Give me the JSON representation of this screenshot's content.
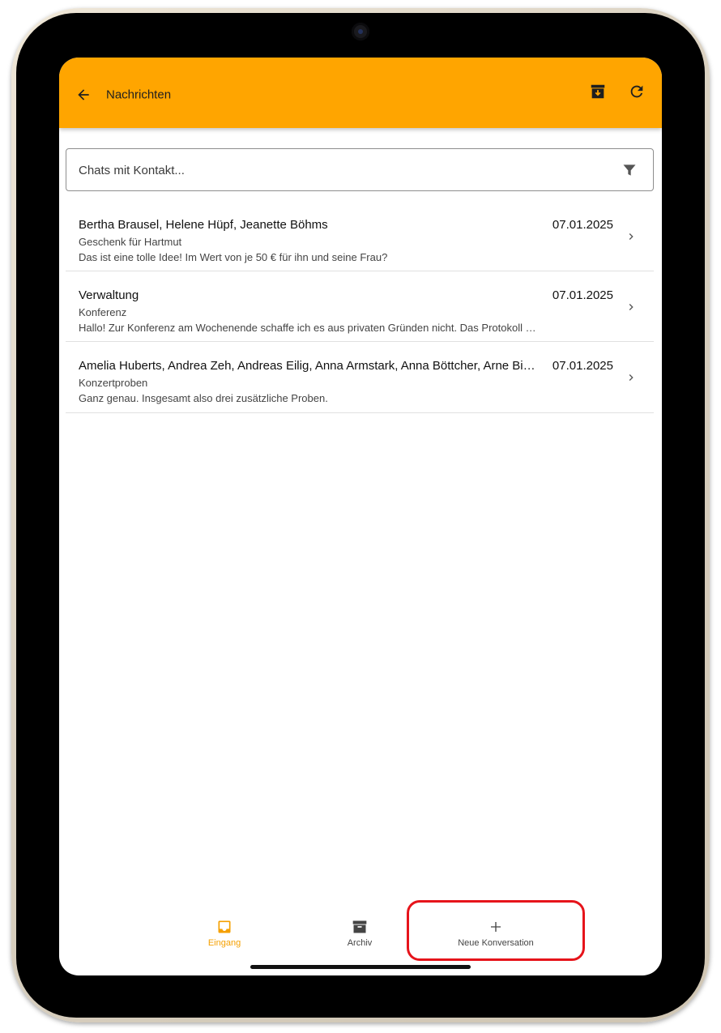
{
  "colors": {
    "accent": "#FFA500",
    "nav_active": "#F5A000",
    "nav_inactive": "#444444",
    "highlight": "#E6141B"
  },
  "header": {
    "title": "Nachrichten",
    "back_icon": "arrow-left-icon",
    "archive_icon": "archive-download-icon",
    "refresh_icon": "refresh-icon"
  },
  "search": {
    "placeholder": "Chats mit Kontakt...",
    "value": "",
    "filter_icon": "filter-icon"
  },
  "chats": [
    {
      "names": "Bertha Brausel, Helene Hüpf, Jeanette Böhms",
      "date": "07.01.2025",
      "subject": "Geschenk für Hartmut",
      "preview": "Das ist eine tolle Idee! Im Wert von je 50 € für ihn und seine Frau?"
    },
    {
      "names": "Verwaltung",
      "date": "07.01.2025",
      "subject": "Konferenz",
      "preview": "Hallo! Zur Konferenz am Wochenende schaffe ich es aus privaten Gründen nicht. Das Protokoll müsste also jemand anderes übernehmen."
    },
    {
      "names": "Amelia Huberts, Andrea Zeh, Andreas Eilig, Anna Armstark, Anna Böttcher, Arne Bis...",
      "date": "07.01.2025",
      "subject": "Konzertproben",
      "preview": "Ganz genau. Insgesamt also drei zusätzliche Proben."
    }
  ],
  "bottom_nav": [
    {
      "label": "Eingang",
      "icon": "inbox-icon",
      "active": true
    },
    {
      "label": "Archiv",
      "icon": "archive-box-icon",
      "active": false
    },
    {
      "label": "Neue Konversation",
      "icon": "plus-icon",
      "active": false
    }
  ]
}
